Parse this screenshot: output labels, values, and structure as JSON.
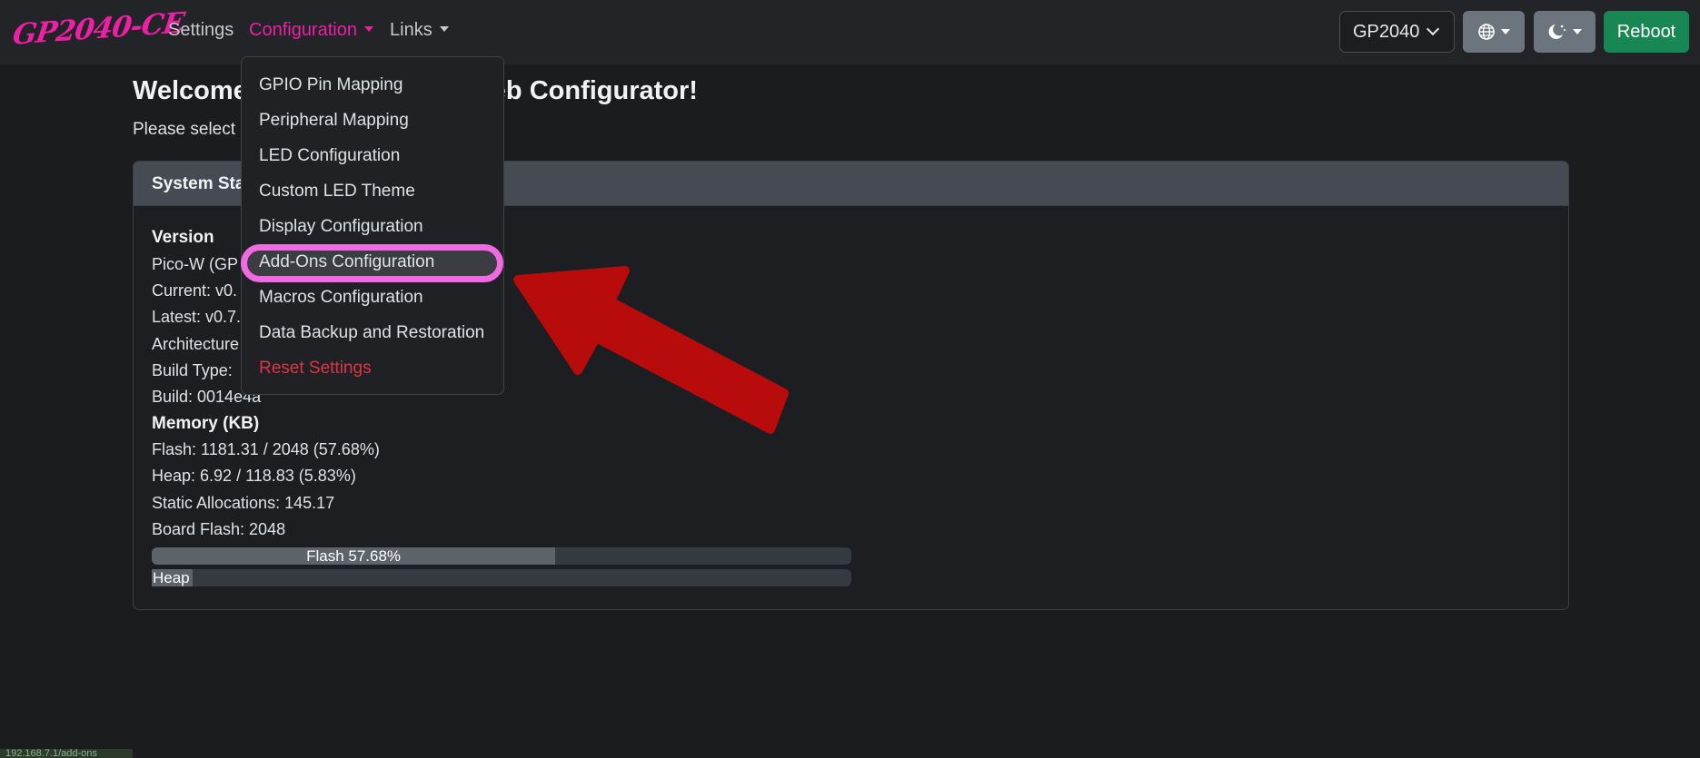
{
  "brand": "GP2040-CE",
  "nav": {
    "settings": "Settings",
    "configuration": "Configuration",
    "links": "Links"
  },
  "toolbar": {
    "device": "GP2040",
    "language_icon": "globe-icon",
    "theme_icon": "moon-stars-icon",
    "reboot": "Reboot"
  },
  "colors": {
    "accent": "#ec1fa5",
    "reboot": "#198754",
    "danger": "#dc3545",
    "highlight": "#f06ae2",
    "arrow": "#b80c0c"
  },
  "page": {
    "title_start": "Welcome",
    "title_end": "eb Configurator!",
    "subtitle": "Please select a"
  },
  "dropdown": {
    "items": [
      "GPIO Pin Mapping",
      "Peripheral Mapping",
      "LED Configuration",
      "Custom LED Theme",
      "Display Configuration",
      "Add-Ons Configuration",
      "Macros Configuration",
      "Data Backup and Restoration",
      "Reset Settings"
    ],
    "highlighted_index": 5
  },
  "system": {
    "header": "System Sta",
    "version_heading": "Version",
    "board": "Pico-W (GP",
    "current": "Current: v0.",
    "latest": "Latest: v0.7.",
    "architecture": "Architecture",
    "build_type": "Build Type:",
    "build": "Build: 0014e4a",
    "memory_heading": "Memory (KB)",
    "flash": "Flash: 1181.31 / 2048 (57.68%)",
    "heap": "Heap: 6.92 / 118.83 (5.83%)",
    "static_alloc": "Static Allocations: 145.17",
    "board_flash": "Board Flash: 2048",
    "flash_bar": {
      "label": "Flash 57.68%",
      "percent": 57.68
    },
    "heap_bar": {
      "label": "Heap",
      "percent": 5.83
    }
  },
  "status_url": "192.168.7.1/add-ons"
}
